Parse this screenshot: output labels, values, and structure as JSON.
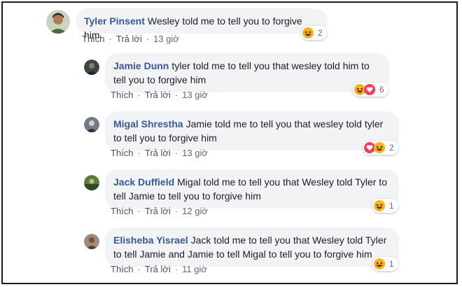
{
  "actions": {
    "like": "Thích",
    "reply": "Trả lời",
    "separator": "·"
  },
  "colors": {
    "author": "#385898",
    "bubble": "#f2f3f5",
    "haha": "#f7b125",
    "love": "#f33e58"
  },
  "comments": [
    {
      "author": "Tyler Pinsent",
      "text": "Wesley told me to tell you to forgive him",
      "time": "13 giờ",
      "reactions": [
        "haha-icon"
      ],
      "reaction_count": "2"
    },
    {
      "author": "Jamie Dunn",
      "text": "tyler told me to tell you that wesley told him to tell you to forgive him",
      "time": "13 giờ",
      "reactions": [
        "haha-icon",
        "love-icon"
      ],
      "reaction_count": "6"
    },
    {
      "author": "Migal Shrestha",
      "text": "Jamie told me to tell you that wesley told tyler to tell you to forgive him",
      "time": "13 giờ",
      "reactions": [
        "love-icon",
        "haha-icon"
      ],
      "reaction_count": "2"
    },
    {
      "author": "Jack Duffield",
      "text": "Migal told me to tell you that Wesley told Tyler to tell Jamie to tell you to forgive him",
      "time": "12 giờ",
      "reactions": [
        "haha-icon"
      ],
      "reaction_count": "1"
    },
    {
      "author": "Elisheba Yisrael",
      "text": "Jack told me to tell you that Wesley told Tyler to tell Jamie and Jamie to tell Migal to tell you to forgive him",
      "time": "11 giờ",
      "reactions": [
        "haha-icon"
      ],
      "reaction_count": "1"
    }
  ]
}
